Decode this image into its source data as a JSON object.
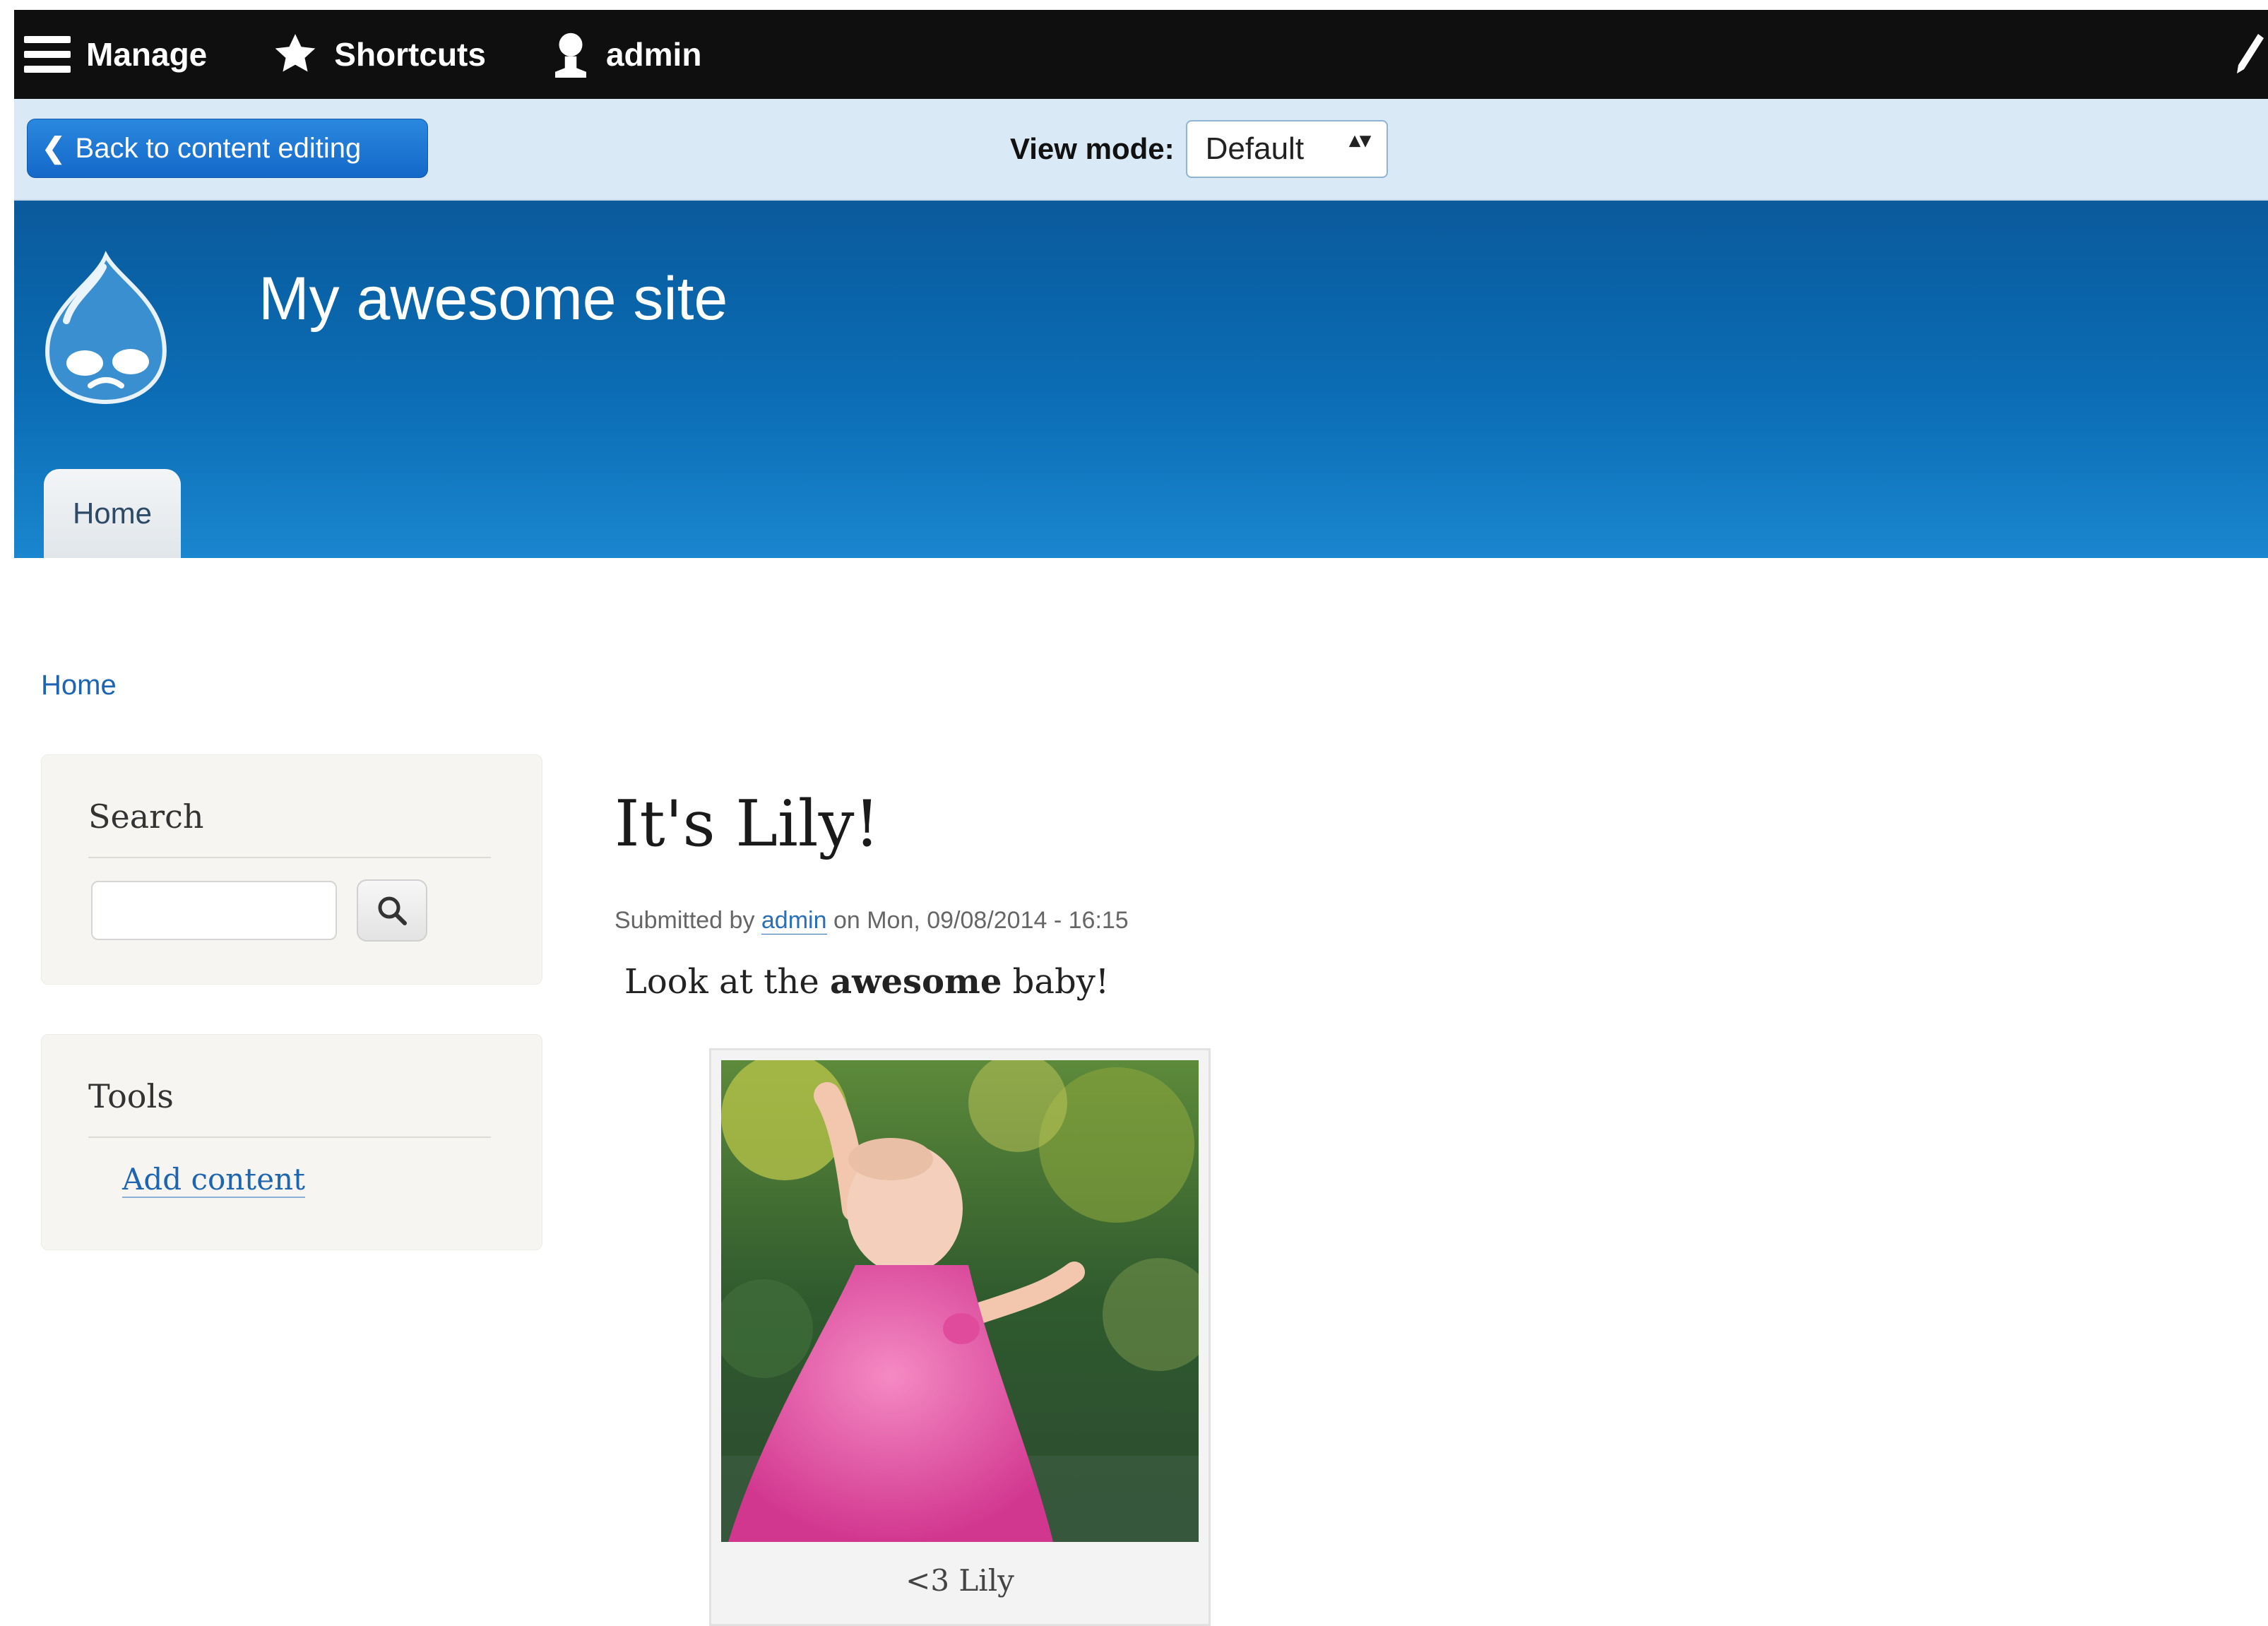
{
  "toolbar": {
    "manage_label": "Manage",
    "shortcuts_label": "Shortcuts",
    "user_label": "admin",
    "icons": [
      "menu-icon",
      "star-icon",
      "user-icon",
      "pencil-icon"
    ]
  },
  "viewbar": {
    "back_label": "Back to content editing",
    "view_mode_label": "View mode:",
    "view_mode_value": "Default",
    "view_mode_arrows": "▴▾"
  },
  "header": {
    "site_name": "My awesome site",
    "home_tab": "Home"
  },
  "breadcrumb": "Home",
  "sidebar": {
    "search_title": "Search",
    "search_placeholder": "",
    "tools_title": "Tools",
    "add_content_link": "Add content"
  },
  "node": {
    "title": "It's Lily!",
    "submitted_prefix": "Submitted by ",
    "author": "admin",
    "submitted_suffix": " on Mon, 09/08/2014 - 16:15",
    "body_prefix": "Look at the ",
    "body_bold": "awesome",
    "body_suffix": " baby!",
    "image_caption": "<3 Lily"
  },
  "colors": {
    "toolbar_bg": "#0f0f0f",
    "viewbar_bg": "#d9e9f6",
    "header_blue": "#0b6db5",
    "link_blue": "#1d65b0",
    "back_button_blue": "#1c74d4"
  }
}
